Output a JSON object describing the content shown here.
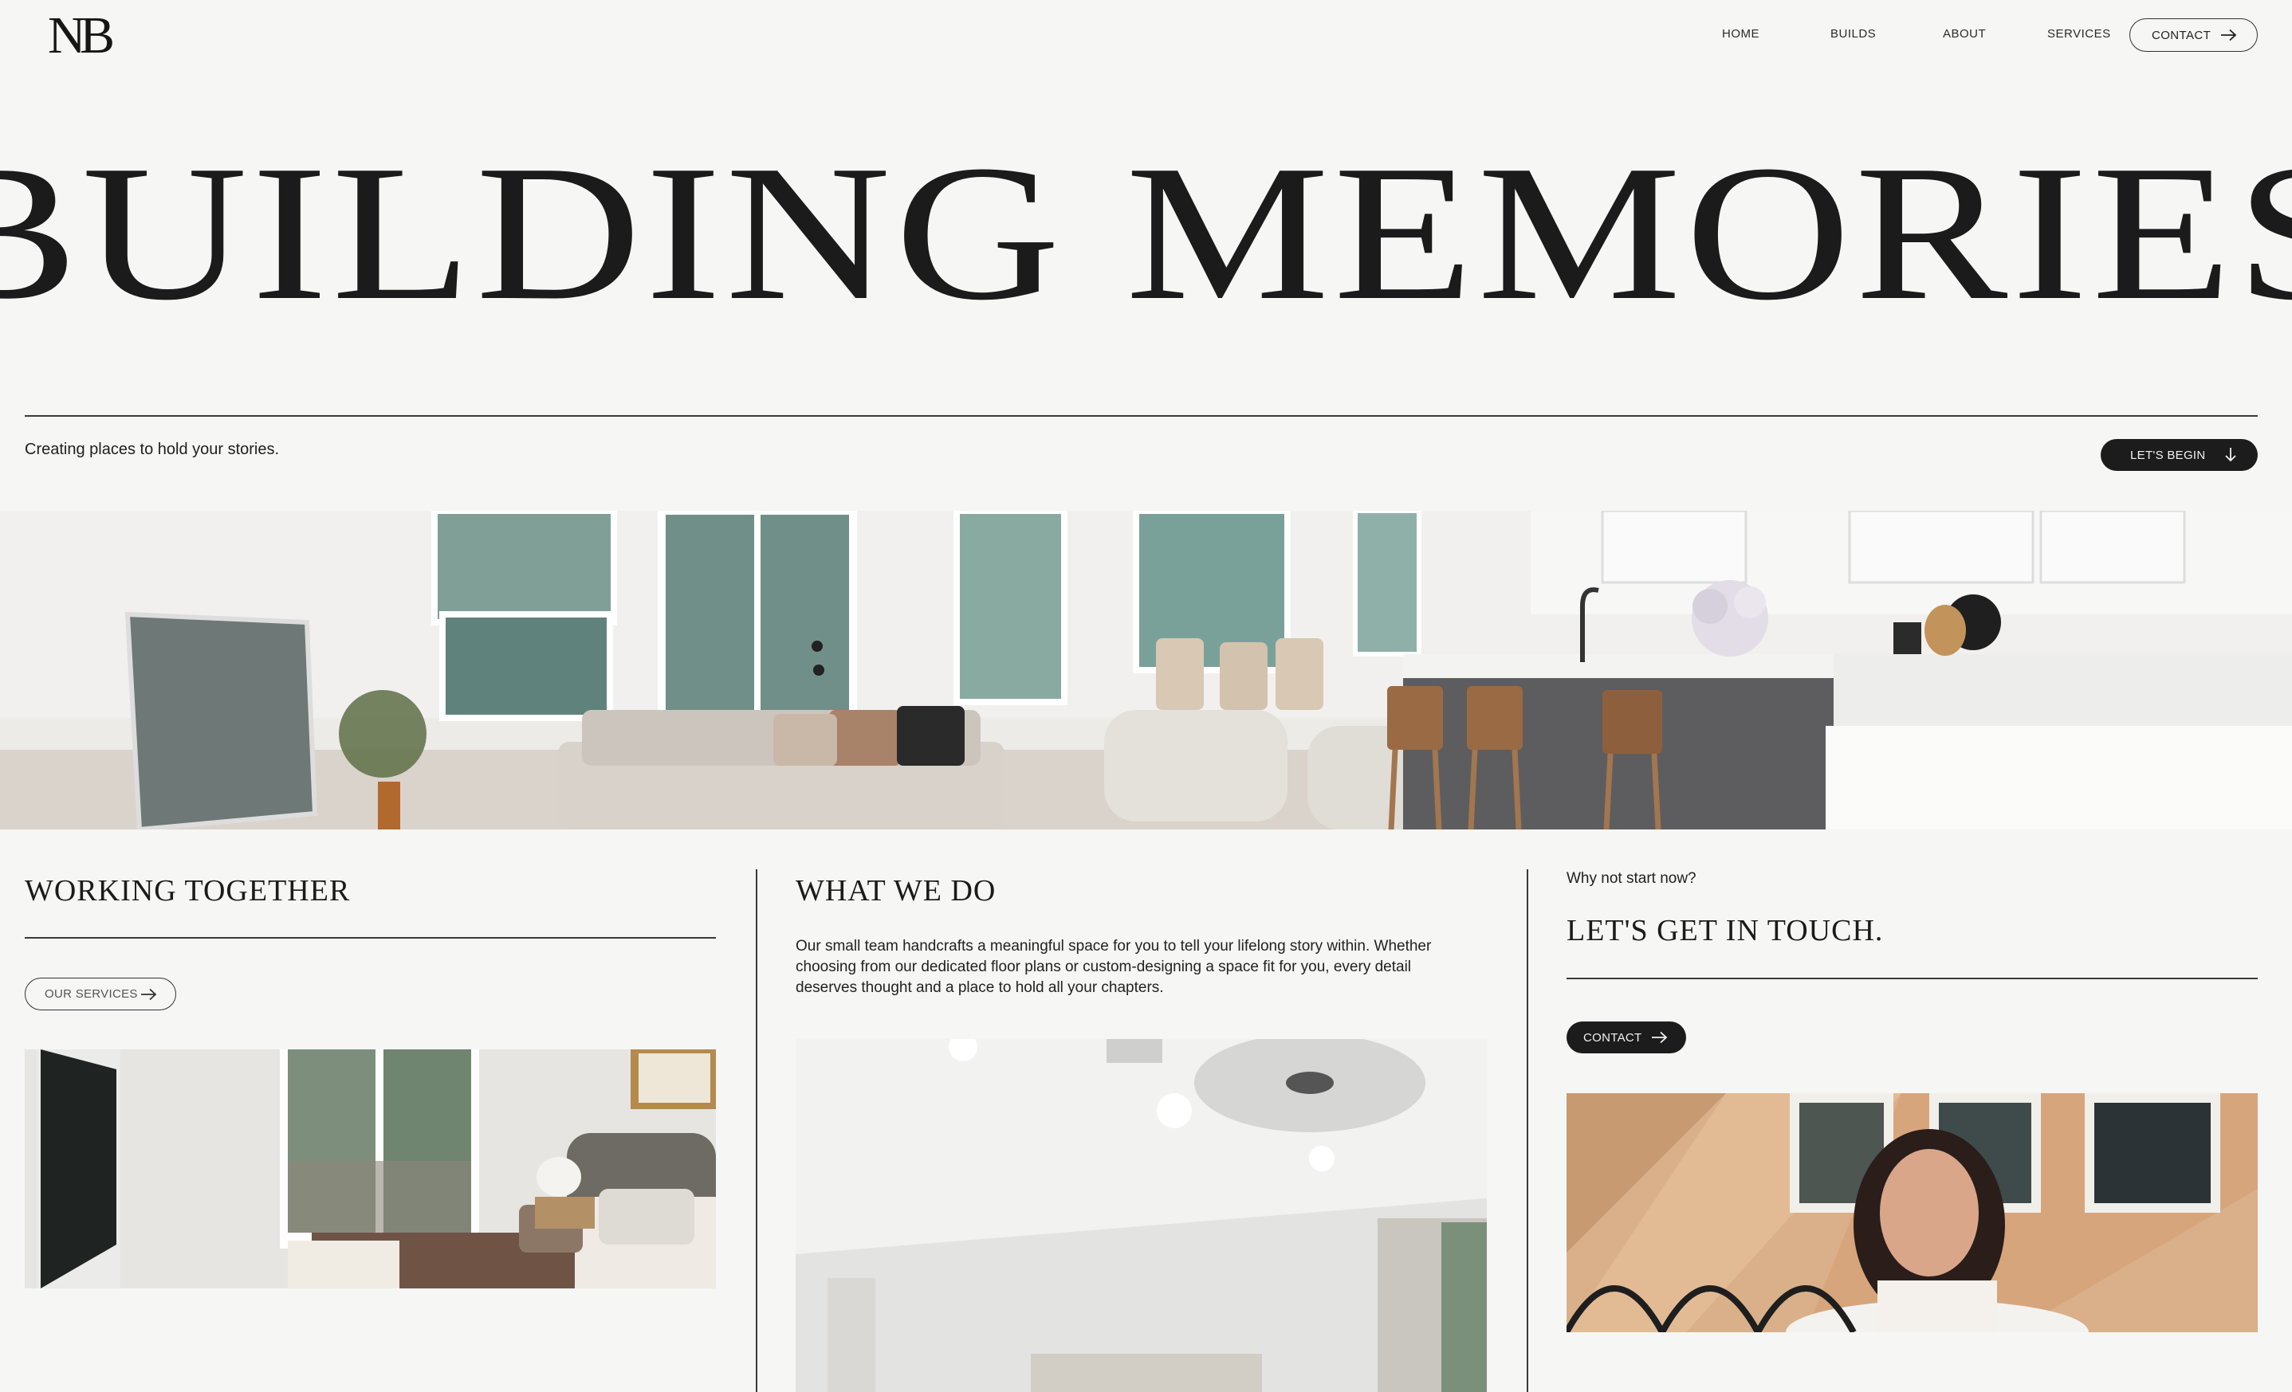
{
  "brand": {
    "logo_text_n": "N",
    "logo_text_b": "B"
  },
  "nav": {
    "items": [
      {
        "label": "HOME"
      },
      {
        "label": "BUILDS"
      },
      {
        "label": "ABOUT"
      },
      {
        "label": "SERVICES"
      }
    ],
    "contact_label": "CONTACT"
  },
  "hero": {
    "title": "BUILDING MEMORIES",
    "tagline": "Creating places to hold your stories.",
    "cta_label": "LET'S BEGIN"
  },
  "columns": {
    "working": {
      "title": "WORKING TOGETHER",
      "button_label": "OUR SERVICES"
    },
    "what": {
      "title": "WHAT WE DO",
      "body": "Our small team handcrafts a meaningful space for you to tell your lifelong story within. Whether choosing from our dedicated floor plans or custom-designing a space fit for you, every detail deserves thought and a place to hold all your chapters."
    },
    "touch": {
      "kicker": "Why not start now?",
      "title": "LET'S GET IN TOUCH.",
      "button_label": "CONTACT"
    }
  },
  "icons": {
    "arrow_right": "arrow-right-icon",
    "arrow_down": "arrow-down-icon"
  },
  "colors": {
    "background": "#f6f6f5",
    "ink": "#1a1a1a",
    "button_dark": "#1c1c1c"
  }
}
